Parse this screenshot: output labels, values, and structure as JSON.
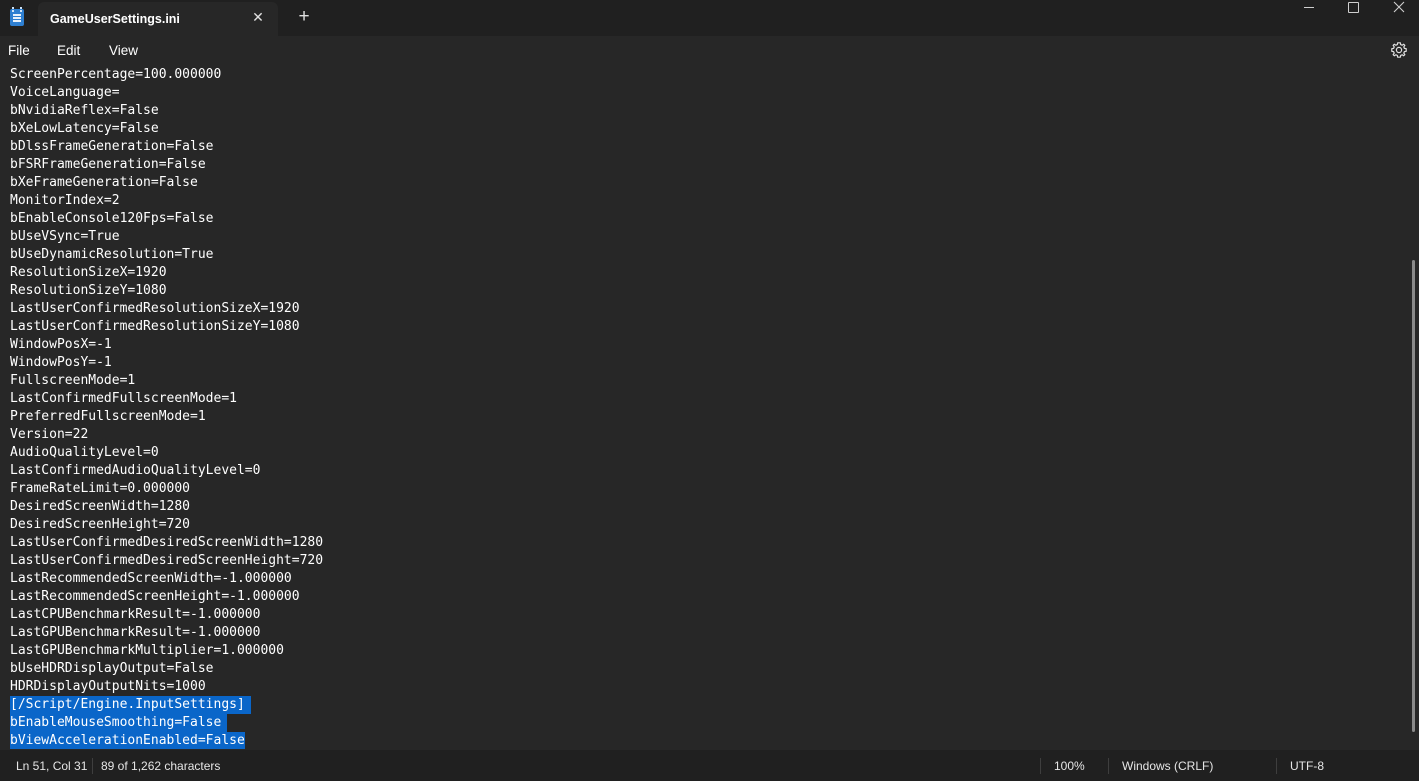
{
  "window": {
    "tab_title": "GameUserSettings.ini",
    "tab_close_glyph": "✕",
    "new_tab_glyph": "+"
  },
  "menu": {
    "file": "File",
    "edit": "Edit",
    "view": "View"
  },
  "icons": {
    "app": "notepad-icon",
    "settings": "gear-icon",
    "minimize": "minimize-icon",
    "maximize": "maximize-icon",
    "close": "close-icon"
  },
  "editor": {
    "selection_color": "#0a66c9",
    "lines": [
      "ScreenPercentage=100.000000",
      "VoiceLanguage=",
      "bNvidiaReflex=False",
      "bXeLowLatency=False",
      "bDlssFrameGeneration=False",
      "bFSRFrameGeneration=False",
      "bXeFrameGeneration=False",
      "MonitorIndex=2",
      "bEnableConsole120Fps=False",
      "bUseVSync=True",
      "bUseDynamicResolution=True",
      "ResolutionSizeX=1920",
      "ResolutionSizeY=1080",
      "LastUserConfirmedResolutionSizeX=1920",
      "LastUserConfirmedResolutionSizeY=1080",
      "WindowPosX=-1",
      "WindowPosY=-1",
      "FullscreenMode=1",
      "LastConfirmedFullscreenMode=1",
      "PreferredFullscreenMode=1",
      "Version=22",
      "AudioQualityLevel=0",
      "LastConfirmedAudioQualityLevel=0",
      "FrameRateLimit=0.000000",
      "DesiredScreenWidth=1280",
      "DesiredScreenHeight=720",
      "LastUserConfirmedDesiredScreenWidth=1280",
      "LastUserConfirmedDesiredScreenHeight=720",
      "LastRecommendedScreenWidth=-1.000000",
      "LastRecommendedScreenHeight=-1.000000",
      "LastCPUBenchmarkResult=-1.000000",
      "LastGPUBenchmarkResult=-1.000000",
      "LastGPUBenchmarkMultiplier=1.000000",
      "bUseHDRDisplayOutput=False",
      "HDRDisplayOutputNits=1000",
      "[/Script/Engine.InputSettings]",
      "bEnableMouseSmoothing=False",
      "bViewAccelerationEnabled=False"
    ],
    "selected_from": 35
  },
  "status": {
    "position": "Ln 51, Col 31",
    "selection": "89 of 1,262 characters",
    "zoom": "100%",
    "line_ending": "Windows (CRLF)",
    "encoding": "UTF-8"
  }
}
